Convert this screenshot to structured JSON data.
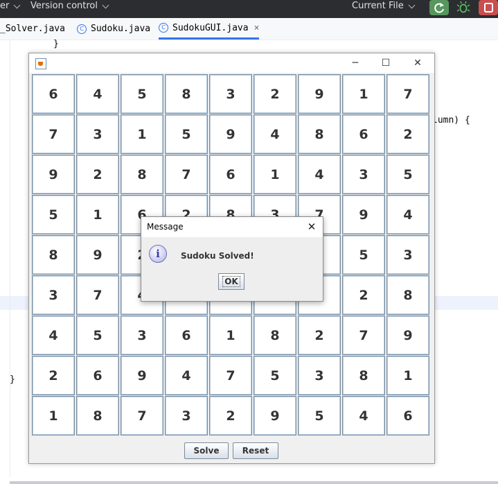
{
  "ide": {
    "menu_left": "er",
    "version_control": "Version control",
    "run_config": "Current File",
    "tabs": [
      {
        "label": "_Solver.java",
        "active": false
      },
      {
        "label": "Sudoku.java",
        "active": false
      },
      {
        "label": "SudokuGUI.java",
        "active": true
      }
    ],
    "tab_close": "×",
    "code": {
      "brace_top": "}",
      "param_fragment": "lumn) {",
      "brace_bottom": "}"
    },
    "colors": {
      "run": "#57965c",
      "stop": "#c94f4f",
      "accent": "#3574f0"
    }
  },
  "frame": {
    "controls": {
      "minimize": "─",
      "maximize": "☐",
      "close": "✕"
    },
    "grid": [
      [
        "6",
        "4",
        "5",
        "8",
        "3",
        "2",
        "9",
        "1",
        "7"
      ],
      [
        "7",
        "3",
        "1",
        "5",
        "9",
        "4",
        "8",
        "6",
        "2"
      ],
      [
        "9",
        "2",
        "8",
        "7",
        "6",
        "1",
        "4",
        "3",
        "5"
      ],
      [
        "5",
        "1",
        "6",
        "2",
        "8",
        "3",
        "7",
        "9",
        "4"
      ],
      [
        "8",
        "9",
        "2",
        "",
        "",
        "",
        "",
        "5",
        "3"
      ],
      [
        "3",
        "7",
        "4",
        "",
        "",
        "",
        "",
        "2",
        "8"
      ],
      [
        "4",
        "5",
        "3",
        "6",
        "1",
        "8",
        "2",
        "7",
        "9"
      ],
      [
        "2",
        "6",
        "9",
        "4",
        "7",
        "5",
        "3",
        "8",
        "1"
      ],
      [
        "1",
        "8",
        "7",
        "3",
        "2",
        "9",
        "5",
        "4",
        "6"
      ]
    ],
    "solve_label": "Solve",
    "reset_label": "Reset"
  },
  "dialog": {
    "title": "Message",
    "close": "✕",
    "icon": "information-icon",
    "icon_glyph": "i",
    "message": "Sudoku Solved!",
    "ok_label": "OK"
  }
}
